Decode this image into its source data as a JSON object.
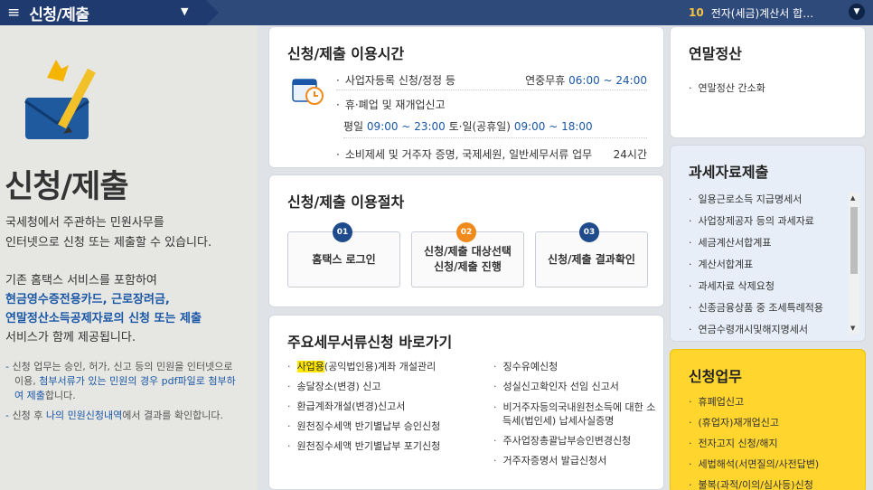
{
  "topbar": {
    "menu_icon": "hamburger-icon",
    "menu_title": "신청/제출",
    "dropdown_caret": "▼",
    "ticker_num": "10",
    "ticker_text": "전자(세금)계산서 합…",
    "ticker_btn": "chevron-down-icon"
  },
  "intro": {
    "title": "신청/제출",
    "desc_line1": "국세청에서 주관하는 민원사무를",
    "desc_line2": "인터넷으로 신청 또는 제출할 수 있습니다.",
    "desc2_line1": "기존 홈택스 서비스를 포함하여",
    "desc2_blue1": "현금영수증전용카드, 근로장려금,",
    "desc2_blue2": "연말정산소득공제자료의 신청 또는 제출",
    "desc2_line4": "서비스가 함께 제공됩니다.",
    "note1_a": "신청 업무는 승인, 허가, 신고 등의 민원을 인터넷으로 이용,",
    "note1_hl": "첨부서류가 있는 민원의 경우 pdf파일로 첨부하여 제출",
    "note1_b": "합니다.",
    "note2_a": "신청 후",
    "note2_hl": "나의 민원신청내역",
    "note2_b": "에서 결과를 확인합니다."
  },
  "hours": {
    "title": "신청/제출 이용시간",
    "row1_label": "사업자등록 신청/정정 등",
    "row1_prefix": "연중무휴",
    "row1_time": "06:00 ~ 24:00",
    "row2_label": "휴·폐업 및 재개업신고",
    "row3_a": "평일",
    "row3_t1": "09:00 ~ 23:00",
    "row3_b": "토·일(공휴일)",
    "row3_t2": "09:00 ~ 18:00",
    "row4_label": "소비제세 및 거주자 증명, 국제세원, 일반세무서류 업무",
    "row4_val": "24시간"
  },
  "procedure": {
    "title": "신청/제출 이용절차",
    "steps": [
      {
        "num": "01",
        "label1": "홈택스 로그인",
        "label2": ""
      },
      {
        "num": "02",
        "label1": "신청/제출 대상선택",
        "label2": "신청/제출 진행"
      },
      {
        "num": "03",
        "label1": "신청/제출 결과확인",
        "label2": ""
      }
    ]
  },
  "shortcuts": {
    "title": "주요세무서류신청 바로가기",
    "col1": {
      "item0_hl": "사업용",
      "item0_rest": "(공익법인용)계좌 개설관리",
      "items": [
        "송달장소(변경) 신고",
        "환급계좌개설(변경)신고서",
        "원천징수세액 반기별납부 승인신청",
        "원천징수세액 반기별납부 포기신청"
      ]
    },
    "col2": {
      "items": [
        "징수유예신청",
        "성실신고확인자 선임 신고서",
        "비거주자등의국내원천소득에 대한 소득세(법인세) 납세사실증명",
        "주사업장총괄납부승인변경신청",
        "거주자증명서 발급신청서"
      ]
    }
  },
  "year_end": {
    "title": "연말정산",
    "items": [
      "연말정산 간소화"
    ]
  },
  "tax_data": {
    "title": "과세자료제출",
    "items": [
      "일용근로소득 지급명세서",
      "사업장제공자 등의 과세자료",
      "세금계산서합계표",
      "계산서합계표",
      "과세자료 삭제요청",
      "신종금융상품 중 조세특례적용",
      "연금수령개시및해지명세서"
    ]
  },
  "apply": {
    "title": "신청업무",
    "items": [
      "휴폐업신고",
      "(휴업자)재개업신고",
      "전자고지 신청/해지",
      "세법해석(서면질의/사전답변)",
      "불복(과적/이의/심사등)신청"
    ]
  },
  "colors": {
    "navy": "#1f3a6e",
    "accent_blue": "#1a57a6",
    "yellow": "#ffd52e",
    "orange": "#f08a1c"
  }
}
